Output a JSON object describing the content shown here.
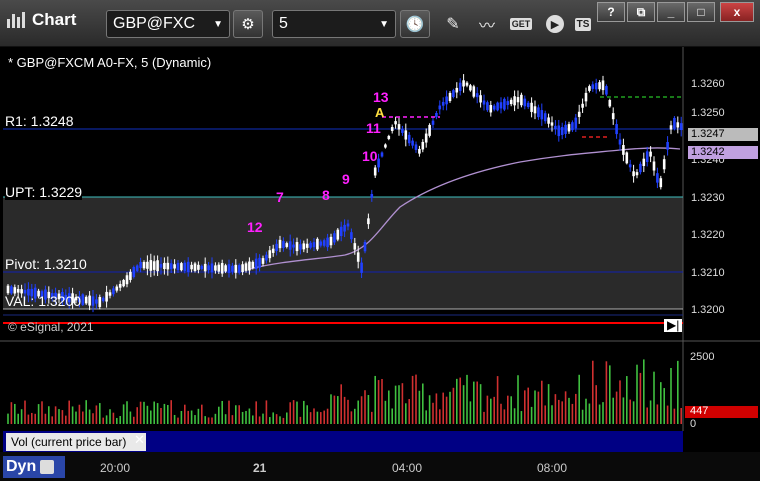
{
  "toolbar": {
    "title": "Chart",
    "symbol": "GBP@FXC",
    "interval": "5",
    "get_label": "GET",
    "ts_label": "TS"
  },
  "window_controls": {
    "help": "?",
    "restore": "⧉",
    "minimize": "_",
    "maximize": "□",
    "close": "x"
  },
  "chart": {
    "symbol_line": "* GBP@FXCM A0-FX, 5 (Dynamic)",
    "copyright": "© eSignal, 2021",
    "levels": {
      "r1": "R1: 1.3248",
      "upt": "UPT: 1.3229",
      "pivot": "Pivot: 1.3210",
      "val": "VAL: 1.3200"
    },
    "price_axis": [
      "1.3260",
      "1.3250",
      "1.3240",
      "1.3230",
      "1.3220",
      "1.3210",
      "1.3200"
    ],
    "current_price": "1.3247",
    "ma_price": "1.3242",
    "counts": [
      "13",
      "A",
      "11",
      "10",
      "9",
      "8",
      "7",
      "12"
    ],
    "volume_axis": [
      "2500",
      "0"
    ],
    "volume_current": "447",
    "volume_label": "Vol (current price bar)",
    "time_axis": [
      "20:00",
      "21",
      "04:00",
      "08:00"
    ],
    "dyn_label": "Dyn",
    "colors": {
      "r1": "#1030c0",
      "upt": "#40c0c0",
      "pivot": "#1020b0",
      "val": "#b0b0b0",
      "red_line": "#ff0000",
      "up": "#ffffff",
      "down": "#2040ff",
      "ma": "#b090d0",
      "count": "#ff20ff"
    }
  }
}
